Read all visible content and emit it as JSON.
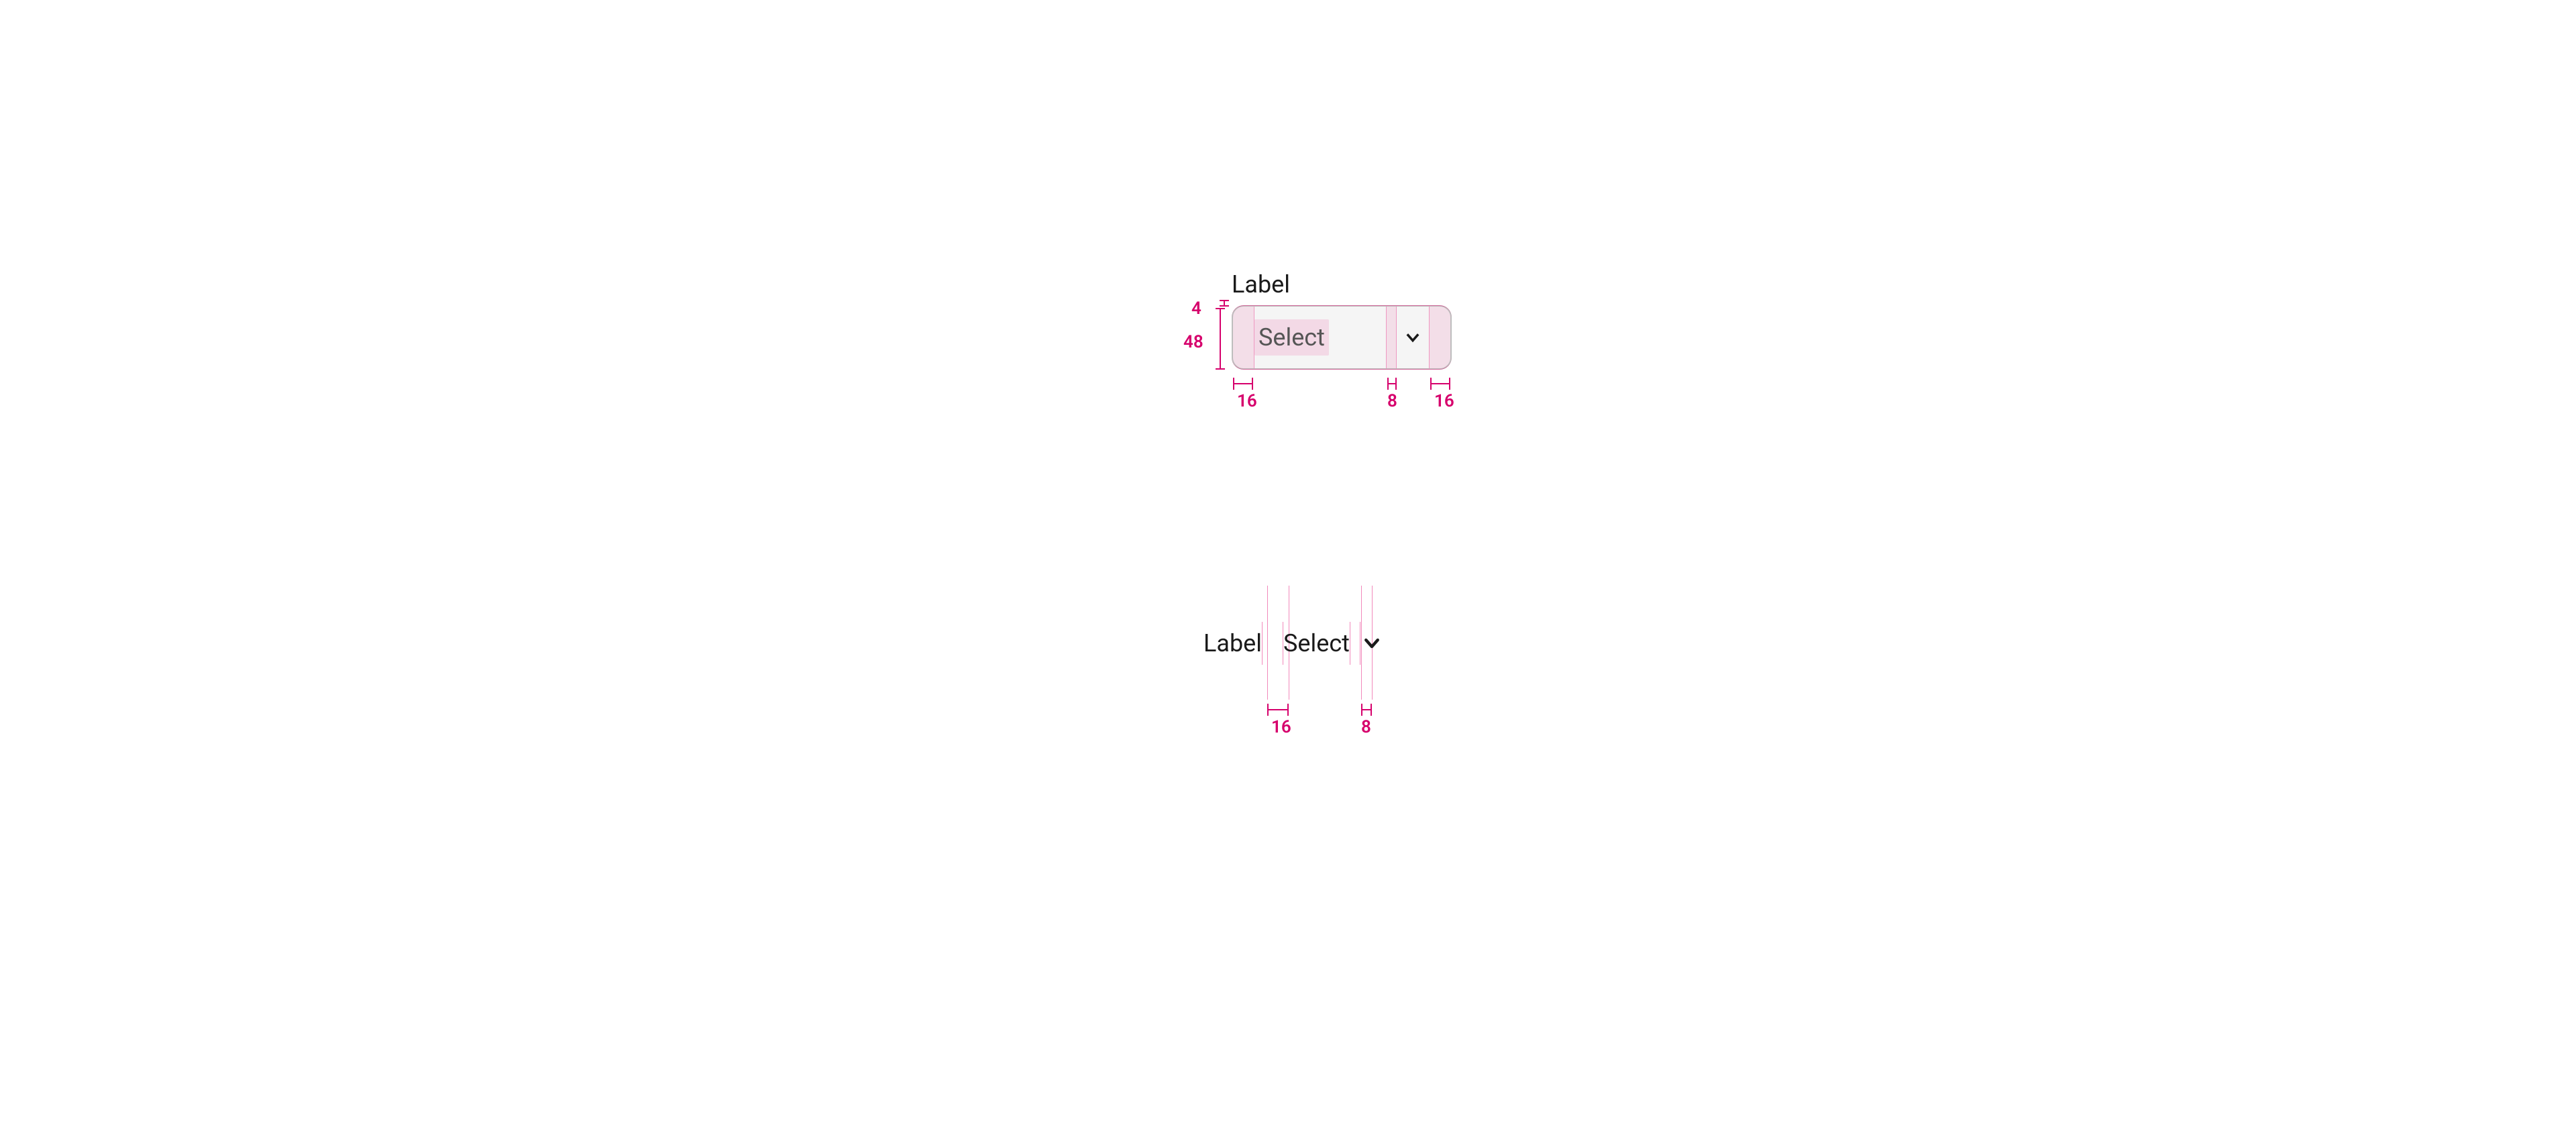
{
  "spec1": {
    "label": "Label",
    "placeholder": "Select",
    "dims": {
      "gap_label_to_box": "4",
      "box_height": "48",
      "pad_left": "16",
      "gap_text_icon": "8",
      "pad_right": "16"
    }
  },
  "spec2": {
    "label": "Label",
    "placeholder": "Select",
    "dims": {
      "gap_label_select": "16",
      "gap_select_icon": "8"
    }
  },
  "colors": {
    "spec_pink": "#d6006c"
  }
}
